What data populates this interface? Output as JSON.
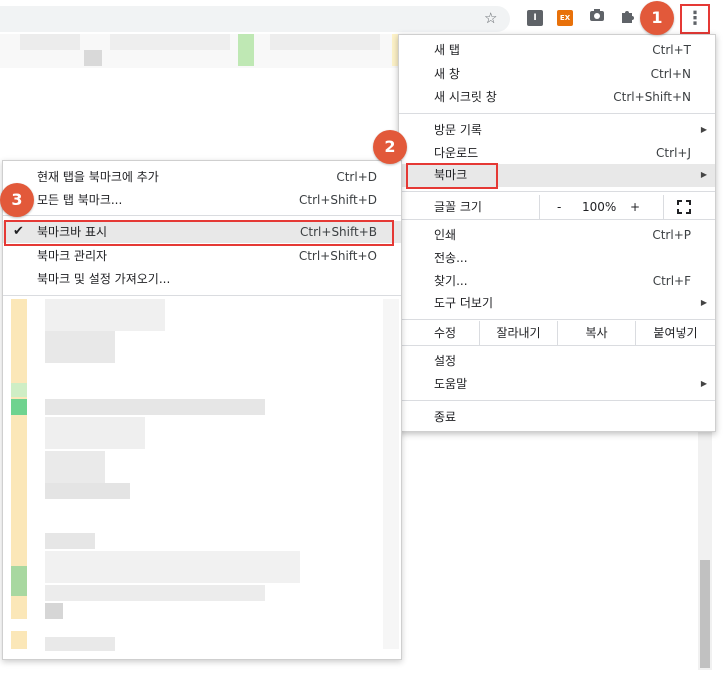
{
  "toolbar": {
    "star_icon": "star-icon",
    "ext_i_label": "I",
    "ext_ex_label": "EX",
    "menu_icon_glyph": "⋮"
  },
  "main_menu": {
    "new_tab": {
      "label": "새 탭",
      "shortcut": "Ctrl+T"
    },
    "new_window": {
      "label": "새 창",
      "shortcut": "Ctrl+N"
    },
    "incognito": {
      "label": "새 시크릿 창",
      "shortcut": "Ctrl+Shift+N"
    },
    "history": {
      "label": "방문 기록"
    },
    "downloads": {
      "label": "다운로드",
      "shortcut": "Ctrl+J"
    },
    "bookmarks": {
      "label": "북마크"
    },
    "zoom": {
      "label": "글꼴 크기",
      "minus": "-",
      "value": "100%",
      "plus": "+"
    },
    "print": {
      "label": "인쇄",
      "shortcut": "Ctrl+P"
    },
    "cast": {
      "label": "전송..."
    },
    "find": {
      "label": "찾기...",
      "shortcut": "Ctrl+F"
    },
    "more_tools": {
      "label": "도구 더보기"
    },
    "edit": {
      "label": "수정",
      "cut": "잘라내기",
      "copy": "복사",
      "paste": "붙여넣기"
    },
    "settings": {
      "label": "설정"
    },
    "help": {
      "label": "도움말"
    },
    "exit": {
      "label": "종료"
    }
  },
  "bookmark_menu": {
    "add_current": {
      "label": "현재 탭을 북마크에 추가",
      "shortcut": "Ctrl+D"
    },
    "add_all": {
      "label": "모든 탭 북마크...",
      "shortcut": "Ctrl+Shift+D"
    },
    "show_bar": {
      "label": "북마크바 표시",
      "shortcut": "Ctrl+Shift+B",
      "checked": true
    },
    "manager": {
      "label": "북마크 관리자",
      "shortcut": "Ctrl+Shift+O"
    },
    "import": {
      "label": "북마크 및 설정 가져오기..."
    }
  },
  "badges": {
    "one": "1",
    "two": "2",
    "three": "3"
  },
  "colors": {
    "accent_red": "#e53935",
    "badge_orange": "#e2593a"
  }
}
